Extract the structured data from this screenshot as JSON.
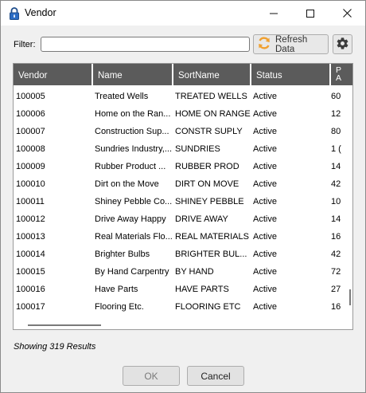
{
  "window": {
    "title": "Vendor",
    "icon": "padlock-icon",
    "controls": [
      "minimize-icon",
      "maximize-icon",
      "close-icon"
    ]
  },
  "toolbar": {
    "filter_label": "Filter:",
    "filter_value": "",
    "refresh_label": "Refresh Data",
    "refresh_icon": "refresh-icon",
    "settings_icon": "gear-icon"
  },
  "grid": {
    "columns": [
      "Vendor",
      "Name",
      "SortName",
      "Status",
      "P\nA"
    ],
    "rows": [
      [
        "100005",
        "Treated Wells",
        "TREATED WELLS",
        "Active",
        "60"
      ],
      [
        "100006",
        "Home on the Ran...",
        "HOME ON RANGE",
        "Active",
        "12"
      ],
      [
        "100007",
        "Construction Sup...",
        "CONSTR SUPLY",
        "Active",
        "80"
      ],
      [
        "100008",
        "Sundries Industry,...",
        "SUNDRIES",
        "Active",
        "1 ("
      ],
      [
        "100009",
        "Rubber Product ...",
        "RUBBER PROD",
        "Active",
        "14"
      ],
      [
        "100010",
        "Dirt on the Move",
        "DIRT ON MOVE",
        "Active",
        "42"
      ],
      [
        "100011",
        "Shiney Pebble Co...",
        "SHINEY PEBBLE",
        "Active",
        "10"
      ],
      [
        "100012",
        "Drive Away Happy",
        "DRIVE AWAY",
        "Active",
        "14"
      ],
      [
        "100013",
        "Real Materials Flo...",
        "REAL MATERIALS",
        "Active",
        "16"
      ],
      [
        "100014",
        "Brighter Bulbs",
        "BRIGHTER BUL...",
        "Active",
        "42"
      ],
      [
        "100015",
        "By Hand Carpentry",
        "BY HAND",
        "Active",
        "72"
      ],
      [
        "100016",
        "Have Parts",
        "HAVE PARTS",
        "Active",
        "27"
      ],
      [
        "100017",
        "Flooring Etc.",
        "FLOORING ETC",
        "Active",
        "16"
      ]
    ]
  },
  "status": {
    "results_text": "Showing 319 Results"
  },
  "footer": {
    "ok_label": "OK",
    "cancel_label": "Cancel"
  },
  "colors": {
    "header_bg": "#5b5b5b",
    "window_bg": "#f0f0f0",
    "refresh_orange": "#f0a030"
  }
}
